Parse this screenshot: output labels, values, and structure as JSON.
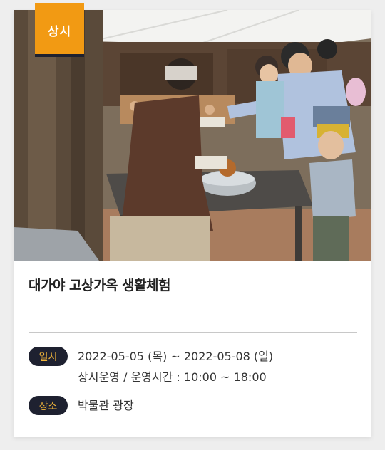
{
  "badge": {
    "label": "상시"
  },
  "photo": {
    "description_icon": "festival-photo"
  },
  "event": {
    "title": "대가야 고상가옥 생활체험",
    "date_label": "일시",
    "date_range": "2022-05-05 (목) ~ 2022-05-08 (일)",
    "hours": "상시운영 / 운영시간 : 10:00 ~ 18:00",
    "place_label": "장소",
    "place": "박물관 광장"
  },
  "colors": {
    "badge_bg": "#f29a13",
    "pill_bg": "#1e2130",
    "pill_text": "#f0b43a"
  }
}
